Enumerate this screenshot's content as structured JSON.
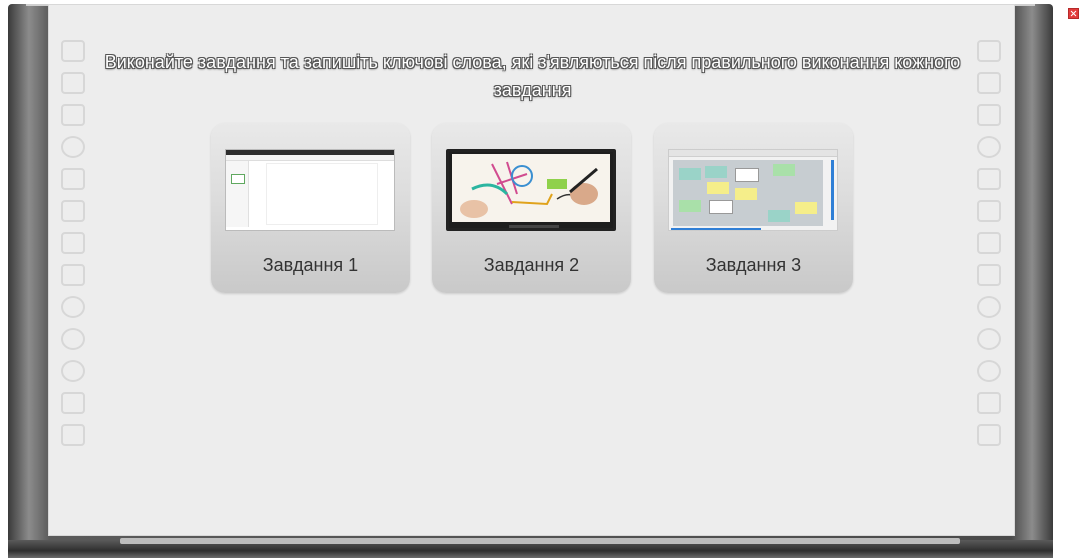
{
  "instruction": "Виконайте завдання та запишіть ключові слова, які з'являються після правильного виконання кожного завдання",
  "tasks": [
    {
      "label": "Завдання 1",
      "thumb_icon": "blank-editor-thumbnail"
    },
    {
      "label": "Завдання 2",
      "thumb_icon": "interactive-display-photo"
    },
    {
      "label": "Завдання 3",
      "thumb_icon": "sticky-notes-board-thumbnail"
    }
  ],
  "controls": {
    "fullscreen_icon": "fullscreen-icon"
  },
  "colors": {
    "board_surface": "#ededed",
    "frame": "#4a4a4a",
    "card": "#d9d9d9",
    "label_text": "#333333",
    "instruction_text": "#ffffff"
  },
  "side_tools": [
    "square",
    "page",
    "page",
    "round",
    "page",
    "text",
    "pen",
    "line",
    "lasso",
    "eraser",
    "curve",
    "hand",
    "K1",
    "grid"
  ]
}
